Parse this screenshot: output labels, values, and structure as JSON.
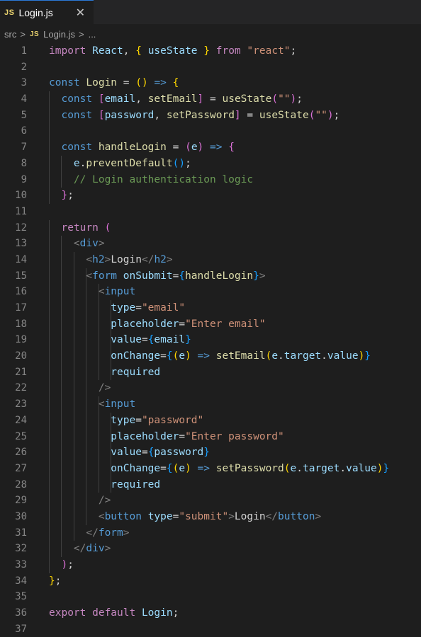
{
  "tab": {
    "badge": "JS",
    "title": "Login.js",
    "close": "✕"
  },
  "breadcrumb": {
    "folder": "src",
    "badge": "JS",
    "file": "Login.js",
    "more": "..."
  },
  "code_lines": [
    [
      [
        "import ",
        "ctrl"
      ],
      [
        "React",
        "var"
      ],
      [
        ", ",
        "op"
      ],
      [
        "{ ",
        "br1"
      ],
      [
        "useState",
        "var"
      ],
      [
        " }",
        "br1"
      ],
      [
        " from ",
        "ctrl"
      ],
      [
        "\"react\"",
        "str"
      ],
      [
        ";",
        "op"
      ]
    ],
    [],
    [
      [
        "const ",
        "kw"
      ],
      [
        "Login",
        "fn"
      ],
      [
        " = ",
        "op"
      ],
      [
        "()",
        "br1"
      ],
      [
        " => ",
        "kw"
      ],
      [
        "{",
        "br1"
      ]
    ],
    [
      [
        "  const ",
        "kw"
      ],
      [
        "[",
        "br2"
      ],
      [
        "email",
        "var"
      ],
      [
        ", ",
        "op"
      ],
      [
        "setEmail",
        "fn"
      ],
      [
        "]",
        "br2"
      ],
      [
        " = ",
        "op"
      ],
      [
        "useState",
        "fn"
      ],
      [
        "(",
        "br2"
      ],
      [
        "\"\"",
        "str"
      ],
      [
        ")",
        "br2"
      ],
      [
        ";",
        "op"
      ]
    ],
    [
      [
        "  const ",
        "kw"
      ],
      [
        "[",
        "br2"
      ],
      [
        "password",
        "var"
      ],
      [
        ", ",
        "op"
      ],
      [
        "setPassword",
        "fn"
      ],
      [
        "]",
        "br2"
      ],
      [
        " = ",
        "op"
      ],
      [
        "useState",
        "fn"
      ],
      [
        "(",
        "br2"
      ],
      [
        "\"\"",
        "str"
      ],
      [
        ")",
        "br2"
      ],
      [
        ";",
        "op"
      ]
    ],
    [],
    [
      [
        "  const ",
        "kw"
      ],
      [
        "handleLogin",
        "fn"
      ],
      [
        " = ",
        "op"
      ],
      [
        "(",
        "br2"
      ],
      [
        "e",
        "var"
      ],
      [
        ")",
        "br2"
      ],
      [
        " => ",
        "kw"
      ],
      [
        "{",
        "br2"
      ]
    ],
    [
      [
        "    e",
        "var"
      ],
      [
        ".",
        "op"
      ],
      [
        "preventDefault",
        "fn"
      ],
      [
        "()",
        "br3"
      ],
      [
        ";",
        "op"
      ]
    ],
    [
      [
        "    // Login authentication logic",
        "com"
      ]
    ],
    [
      [
        "  }",
        "br2"
      ],
      [
        ";",
        "op"
      ]
    ],
    [],
    [
      [
        "  return ",
        "ctrl"
      ],
      [
        "(",
        "br2"
      ]
    ],
    [
      [
        "    <",
        "punc"
      ],
      [
        "div",
        "tag"
      ],
      [
        ">",
        "punc"
      ]
    ],
    [
      [
        "      <",
        "punc"
      ],
      [
        "h2",
        "tag"
      ],
      [
        ">",
        "punc"
      ],
      [
        "Login",
        "op"
      ],
      [
        "</",
        "punc"
      ],
      [
        "h2",
        "tag"
      ],
      [
        ">",
        "punc"
      ]
    ],
    [
      [
        "      <",
        "punc"
      ],
      [
        "form ",
        "tag"
      ],
      [
        "onSubmit",
        "attr"
      ],
      [
        "=",
        "op"
      ],
      [
        "{",
        "br3"
      ],
      [
        "handleLogin",
        "fn"
      ],
      [
        "}",
        "br3"
      ],
      [
        ">",
        "punc"
      ]
    ],
    [
      [
        "        <",
        "punc"
      ],
      [
        "input",
        "tag"
      ]
    ],
    [
      [
        "          type",
        "attr"
      ],
      [
        "=",
        "op"
      ],
      [
        "\"email\"",
        "str"
      ]
    ],
    [
      [
        "          placeholder",
        "attr"
      ],
      [
        "=",
        "op"
      ],
      [
        "\"Enter email\"",
        "str"
      ]
    ],
    [
      [
        "          value",
        "attr"
      ],
      [
        "=",
        "op"
      ],
      [
        "{",
        "br3"
      ],
      [
        "email",
        "var"
      ],
      [
        "}",
        "br3"
      ]
    ],
    [
      [
        "          onChange",
        "attr"
      ],
      [
        "=",
        "op"
      ],
      [
        "{",
        "br3"
      ],
      [
        "(",
        "br1"
      ],
      [
        "e",
        "var"
      ],
      [
        ")",
        "br1"
      ],
      [
        " => ",
        "kw"
      ],
      [
        "setEmail",
        "fn"
      ],
      [
        "(",
        "br1"
      ],
      [
        "e",
        "var"
      ],
      [
        ".",
        "op"
      ],
      [
        "target",
        "var"
      ],
      [
        ".",
        "op"
      ],
      [
        "value",
        "var"
      ],
      [
        ")",
        "br1"
      ],
      [
        "}",
        "br3"
      ]
    ],
    [
      [
        "          required",
        "attr"
      ]
    ],
    [
      [
        "        />",
        "punc"
      ]
    ],
    [
      [
        "        <",
        "punc"
      ],
      [
        "input",
        "tag"
      ]
    ],
    [
      [
        "          type",
        "attr"
      ],
      [
        "=",
        "op"
      ],
      [
        "\"password\"",
        "str"
      ]
    ],
    [
      [
        "          placeholder",
        "attr"
      ],
      [
        "=",
        "op"
      ],
      [
        "\"Enter password\"",
        "str"
      ]
    ],
    [
      [
        "          value",
        "attr"
      ],
      [
        "=",
        "op"
      ],
      [
        "{",
        "br3"
      ],
      [
        "password",
        "var"
      ],
      [
        "}",
        "br3"
      ]
    ],
    [
      [
        "          onChange",
        "attr"
      ],
      [
        "=",
        "op"
      ],
      [
        "{",
        "br3"
      ],
      [
        "(",
        "br1"
      ],
      [
        "e",
        "var"
      ],
      [
        ")",
        "br1"
      ],
      [
        " => ",
        "kw"
      ],
      [
        "setPassword",
        "fn"
      ],
      [
        "(",
        "br1"
      ],
      [
        "e",
        "var"
      ],
      [
        ".",
        "op"
      ],
      [
        "target",
        "var"
      ],
      [
        ".",
        "op"
      ],
      [
        "value",
        "var"
      ],
      [
        ")",
        "br1"
      ],
      [
        "}",
        "br3"
      ]
    ],
    [
      [
        "          required",
        "attr"
      ]
    ],
    [
      [
        "        />",
        "punc"
      ]
    ],
    [
      [
        "        <",
        "punc"
      ],
      [
        "button ",
        "tag"
      ],
      [
        "type",
        "attr"
      ],
      [
        "=",
        "op"
      ],
      [
        "\"submit\"",
        "str"
      ],
      [
        ">",
        "punc"
      ],
      [
        "Login",
        "op"
      ],
      [
        "</",
        "punc"
      ],
      [
        "button",
        "tag"
      ],
      [
        ">",
        "punc"
      ]
    ],
    [
      [
        "      </",
        "punc"
      ],
      [
        "form",
        "tag"
      ],
      [
        ">",
        "punc"
      ]
    ],
    [
      [
        "    </",
        "punc"
      ],
      [
        "div",
        "tag"
      ],
      [
        ">",
        "punc"
      ]
    ],
    [
      [
        "  )",
        "br2"
      ],
      [
        ";",
        "op"
      ]
    ],
    [
      [
        "}",
        "br1"
      ],
      [
        ";",
        "op"
      ]
    ],
    [],
    [
      [
        "export ",
        "ctrl"
      ],
      [
        "default ",
        "ctrl"
      ],
      [
        "Login",
        "var"
      ],
      [
        ";",
        "op"
      ]
    ],
    []
  ],
  "colors": {
    "background": "#1e1e1e",
    "tabbar": "#252526",
    "line_number": "#858585",
    "keyword": "#569cd6",
    "control": "#c586c0",
    "variable": "#9cdcfe",
    "function": "#dcdcaa",
    "string": "#ce9178",
    "comment": "#6a9955"
  }
}
